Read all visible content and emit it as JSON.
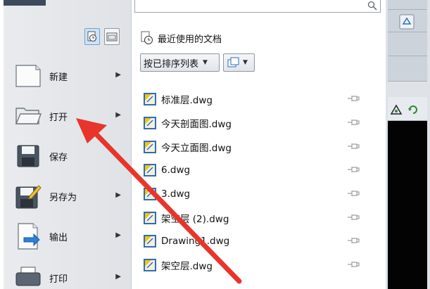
{
  "menu": {
    "items": [
      {
        "label": "新建",
        "icon": "new-document-icon",
        "has_submenu": true
      },
      {
        "label": "打开",
        "icon": "open-folder-icon",
        "has_submenu": true
      },
      {
        "label": "保存",
        "icon": "save-disk-icon",
        "has_submenu": false
      },
      {
        "label": "另存为",
        "icon": "save-as-icon",
        "has_submenu": true
      },
      {
        "label": "输出",
        "icon": "export-icon",
        "has_submenu": true
      },
      {
        "label": "打印",
        "icon": "print-icon",
        "has_submenu": true
      }
    ],
    "view_toggles": [
      "recent-documents-icon",
      "open-documents-icon"
    ]
  },
  "recent": {
    "title": "最近使用的文档",
    "sort_dropdown": "按已排序列表",
    "view_dropdown_icon": "display-mode-icon",
    "files": [
      {
        "name": "标准层.dwg"
      },
      {
        "name": "今天剖面图.dwg"
      },
      {
        "name": "今天立面图.dwg"
      },
      {
        "name": "6.dwg"
      },
      {
        "name": "3.dwg"
      },
      {
        "name": "架空层 (2).dwg"
      },
      {
        "name": "Drawing1.dwg"
      },
      {
        "name": "架空层.dwg"
      }
    ]
  },
  "search": {
    "placeholder": ""
  },
  "colors": {
    "annotation_arrow": "#e8352b",
    "file_icon_blue": "#2f6db5",
    "file_icon_yellow": "#f0c419"
  }
}
